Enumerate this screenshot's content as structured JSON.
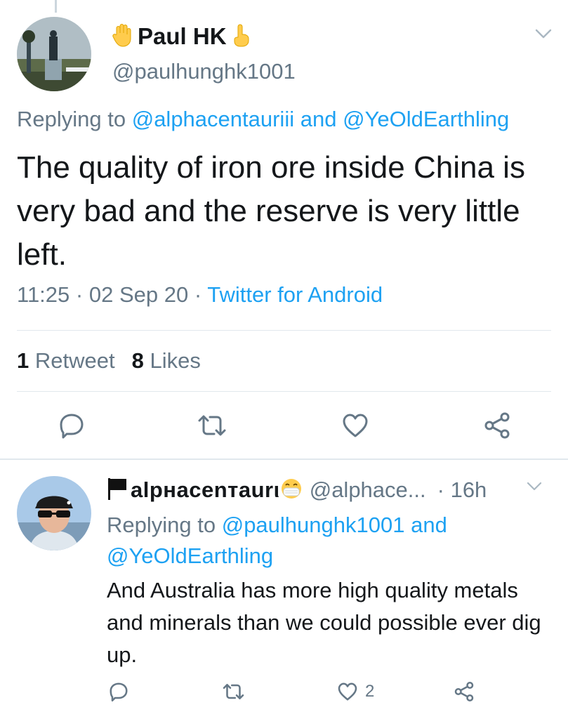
{
  "colors": {
    "link": "#1da1f2",
    "secondary": "#657786",
    "divider": "#e1e8ed",
    "text": "#14171a"
  },
  "main_tweet": {
    "display_name": "Paul HK",
    "name_emoji_left": "raised-hand-emoji",
    "name_emoji_right": "pointing-finger-emoji",
    "handle": "@paulhunghk1001",
    "reply_prefix": "Replying to",
    "reply_to_1": "@alphacentauriii",
    "reply_joiner": "and",
    "reply_to_2": "@YeOldEarthling",
    "text": "The quality of iron ore inside China is very bad and the reserve is very little left.",
    "time": "11:25",
    "separator": "·",
    "date": "02 Sep 20",
    "source": "Twitter for Android",
    "retweets_count": "1",
    "retweets_label": "Retweet",
    "likes_count": "8",
    "likes_label": "Likes"
  },
  "reply_tweet": {
    "display_name": "alpнacenтaurι",
    "name_flag": "black-flag-emoji",
    "name_emoji": "medical-mask-emoji",
    "handle": "@alphace...",
    "time_separator": "·",
    "time": "16h",
    "reply_prefix": "Replying to",
    "reply_to_1": "@paulhunghk1001",
    "reply_joiner": "and",
    "reply_to_2": "@YeOldEarthling",
    "text": "And Australia has more high quality metals and minerals than we could possible ever dig up.",
    "likes_count": "2"
  },
  "icons": [
    "reply-icon",
    "retweet-icon",
    "like-icon",
    "share-icon",
    "chevron-down-icon"
  ]
}
